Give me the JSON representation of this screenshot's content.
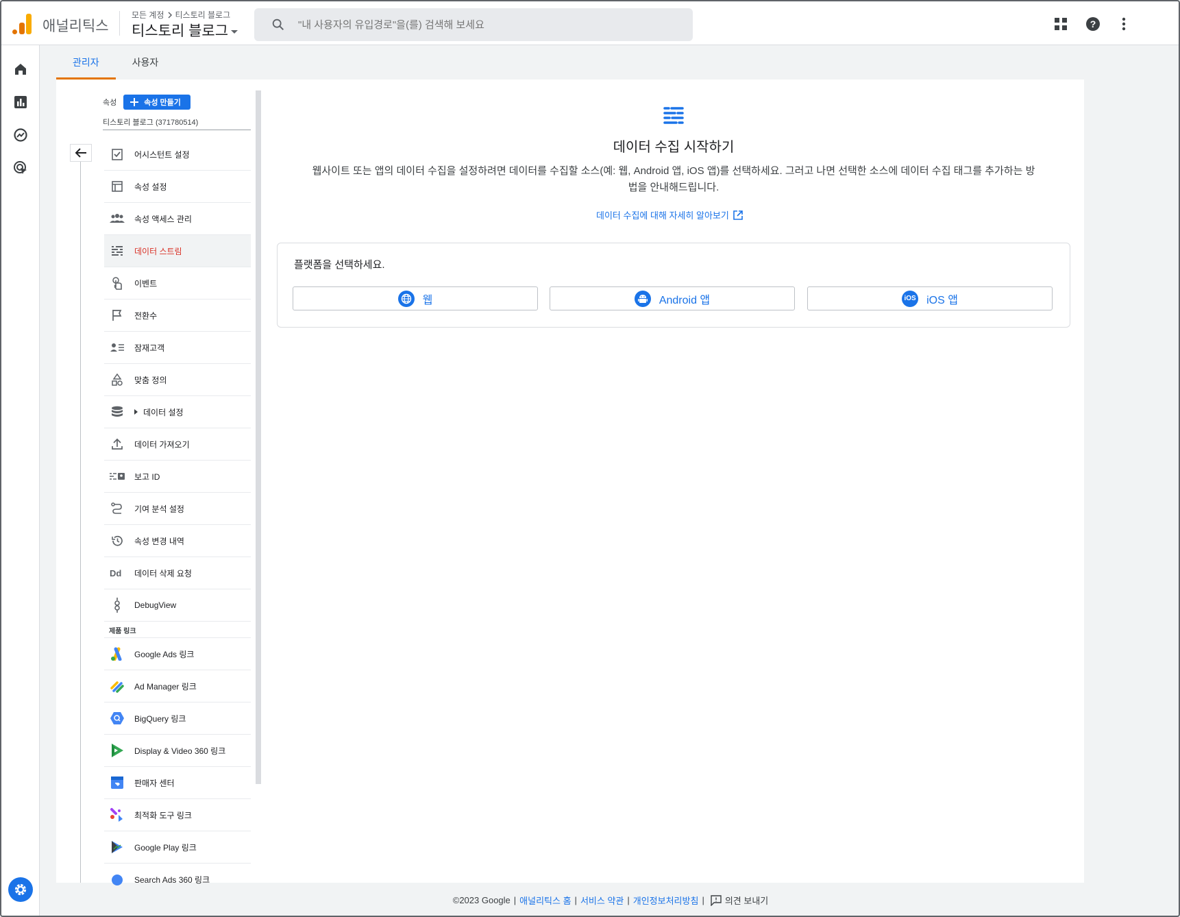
{
  "app": {
    "name": "애널리틱스",
    "brand_color": "#f9ab00",
    "accent": "#1a73e8"
  },
  "header": {
    "breadcrumb": [
      "모든 계정",
      "티스토리 블로그"
    ],
    "property_title": "티스토리 블로그",
    "search_placeholder": "\"내 사용자의 유입경로\"을(를) 검색해 보세요",
    "icons": [
      "apps-icon",
      "help-icon",
      "more-vert-icon"
    ]
  },
  "rail": {
    "items": [
      "home-icon",
      "reports-icon",
      "explore-icon",
      "advertising-icon"
    ],
    "settings_icon": "gear-icon"
  },
  "tabs": [
    {
      "label": "관리자",
      "active": true
    },
    {
      "label": "사용자",
      "active": false
    }
  ],
  "property": {
    "label": "속성",
    "create_button": "속성 만들기",
    "name": "티스토리 블로그 (371780514)"
  },
  "menu": [
    {
      "label": "어시스턴트 설정",
      "icon": "checklist-icon"
    },
    {
      "label": "속성 설정",
      "icon": "property-settings-icon"
    },
    {
      "label": "속성 액세스 관리",
      "icon": "people-icon"
    },
    {
      "label": "데이터 스트림",
      "icon": "data-stream-icon",
      "active": true
    },
    {
      "label": "이벤트",
      "icon": "touch-icon"
    },
    {
      "label": "전환수",
      "icon": "flag-icon"
    },
    {
      "label": "잠재고객",
      "icon": "audience-icon"
    },
    {
      "label": "맞춤 정의",
      "icon": "shapes-icon"
    },
    {
      "label": "데이터 설정",
      "icon": "database-icon",
      "expandable": true
    },
    {
      "label": "데이터 가져오기",
      "icon": "upload-icon"
    },
    {
      "label": "보고 ID",
      "icon": "reporting-id-icon"
    },
    {
      "label": "기여 분석 설정",
      "icon": "attribution-icon"
    },
    {
      "label": "속성 변경 내역",
      "icon": "history-icon"
    },
    {
      "label": "데이터 삭제 요청",
      "icon": "data-deletion-icon"
    },
    {
      "label": "DebugView",
      "icon": "debug-icon"
    }
  ],
  "links_section": {
    "title": "제품 링크",
    "items": [
      {
        "label": "Google Ads 링크",
        "icon": "google-ads-icon"
      },
      {
        "label": "Ad Manager 링크",
        "icon": "ad-manager-icon"
      },
      {
        "label": "BigQuery 링크",
        "icon": "bigquery-icon"
      },
      {
        "label": "Display & Video 360 링크",
        "icon": "dv360-icon"
      },
      {
        "label": "판매자 센터",
        "icon": "merchant-center-icon"
      },
      {
        "label": "최적화 도구 링크",
        "icon": "optimize-icon"
      },
      {
        "label": "Google Play 링크",
        "icon": "google-play-icon"
      },
      {
        "label": "Search Ads 360 링크",
        "icon": "search-ads-icon"
      }
    ]
  },
  "main": {
    "icon": "data-stream-icon",
    "title": "데이터 수집 시작하기",
    "description": "웹사이트 또는 앱의 데이터 수집을 설정하려면 데이터를 수집할 소스(예: 웹, Android 앱, iOS 앱)를 선택하세요. 그러고 나면 선택한 소스에 데이터 수집 태그를 추가하는 방법을 안내해드립니다.",
    "learn_more": "데이터 수집에 대해 자세히 알아보기",
    "platform_prompt": "플랫폼을 선택하세요.",
    "platforms": [
      {
        "label": "웹",
        "icon": "globe-icon"
      },
      {
        "label": "Android 앱",
        "icon": "android-icon"
      },
      {
        "label": "iOS 앱",
        "icon": "ios-icon",
        "badge": "iOS"
      }
    ]
  },
  "footer": {
    "copyright": "©2023 Google",
    "links": [
      "애널리틱스 홈",
      "서비스 약관",
      "개인정보처리방침"
    ],
    "feedback": "의견 보내기"
  }
}
